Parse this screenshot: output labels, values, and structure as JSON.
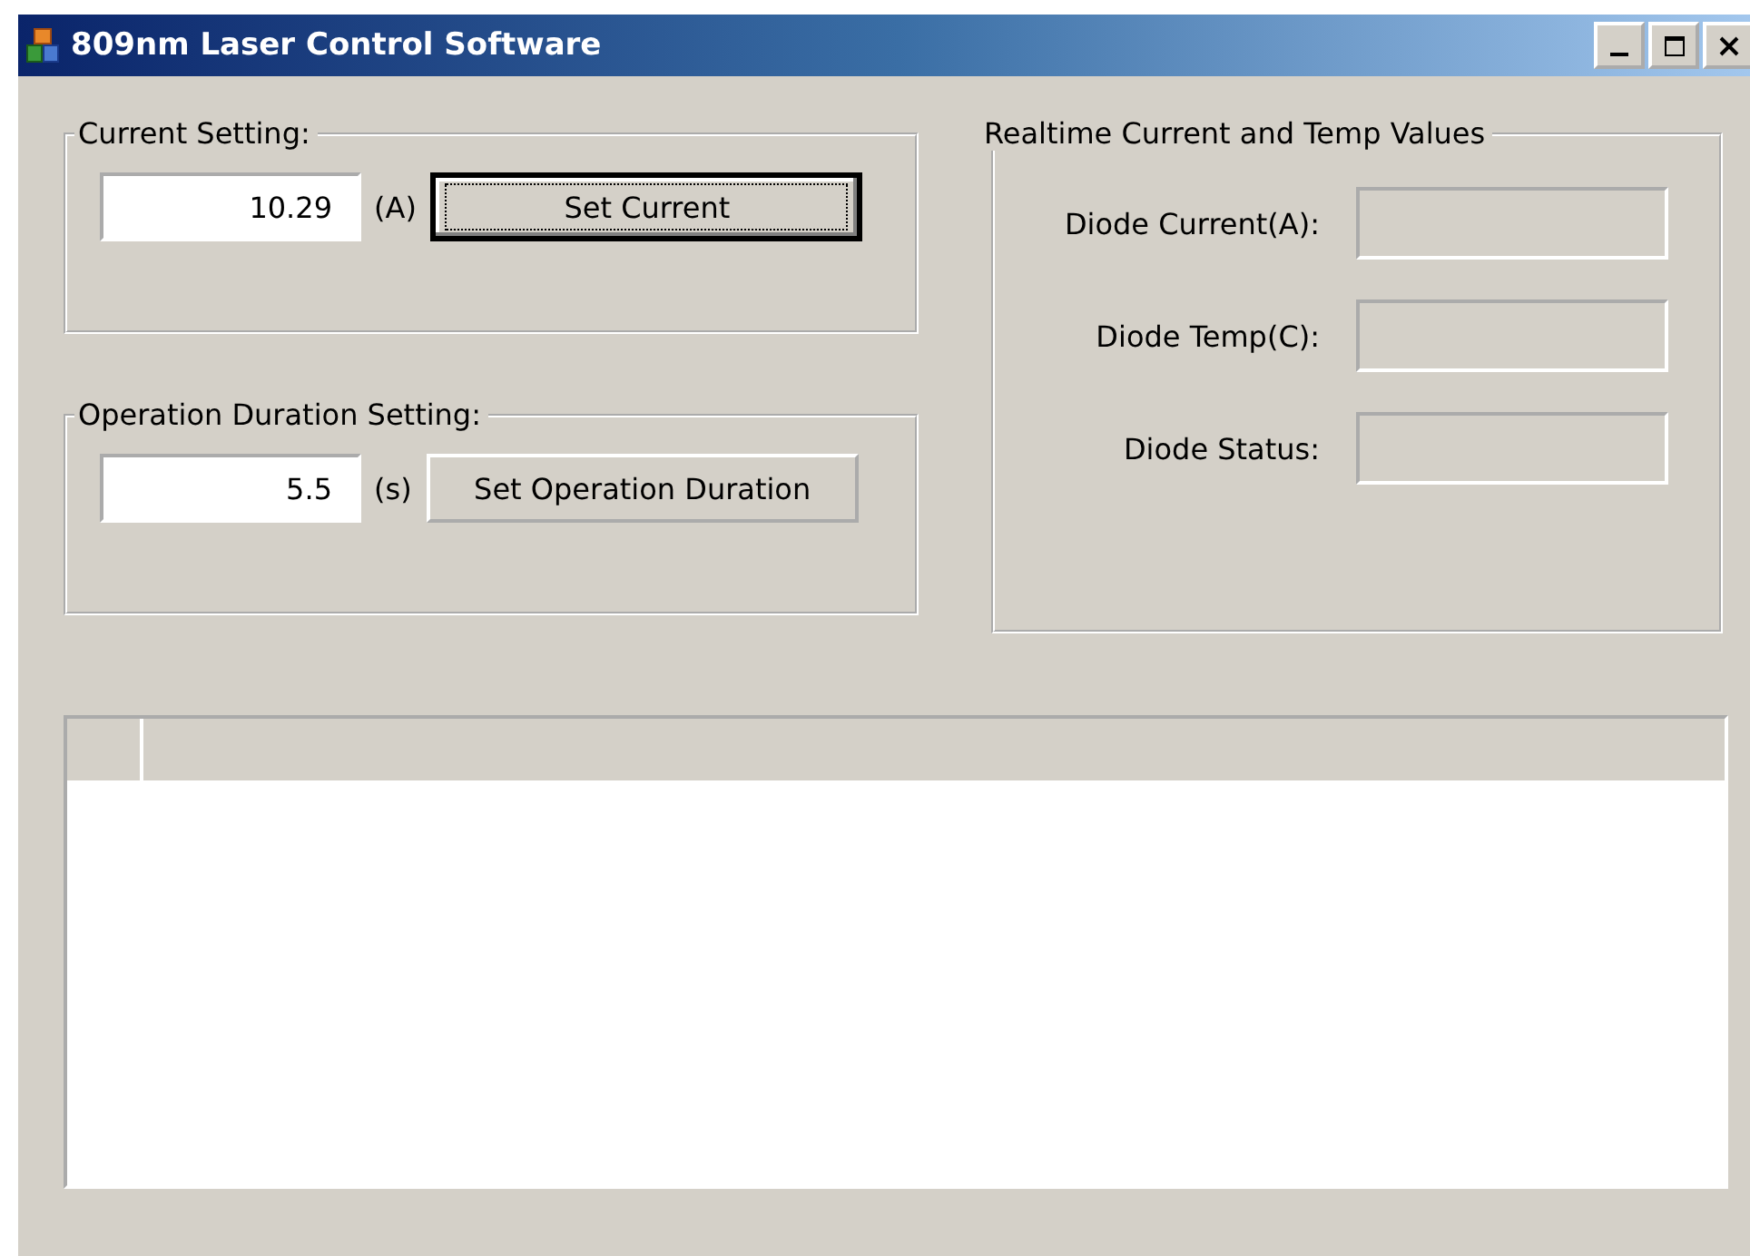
{
  "window": {
    "title": "809nm Laser Control Software",
    "controls": [
      {
        "kind": "minimize"
      },
      {
        "kind": "maximize"
      },
      {
        "kind": "close"
      }
    ]
  },
  "setting_groups": [
    {
      "title": "Current Setting:",
      "value": "10.29",
      "unit": "(A)",
      "button": {
        "label": "Set Current",
        "focused": true
      }
    },
    {
      "title": "Operation Duration Setting:",
      "value": "5.5",
      "unit": "(s)",
      "button": {
        "label": "Set Operation Duration",
        "focused": false
      }
    }
  ],
  "realtime": {
    "title": "Realtime Current and Temp Values",
    "readouts": [
      {
        "label": "Diode Current(A):"
      },
      {
        "label": "Diode Temp(C):"
      },
      {
        "label": "Diode Status:"
      }
    ]
  },
  "grid": {
    "kind": "empty-grid"
  }
}
